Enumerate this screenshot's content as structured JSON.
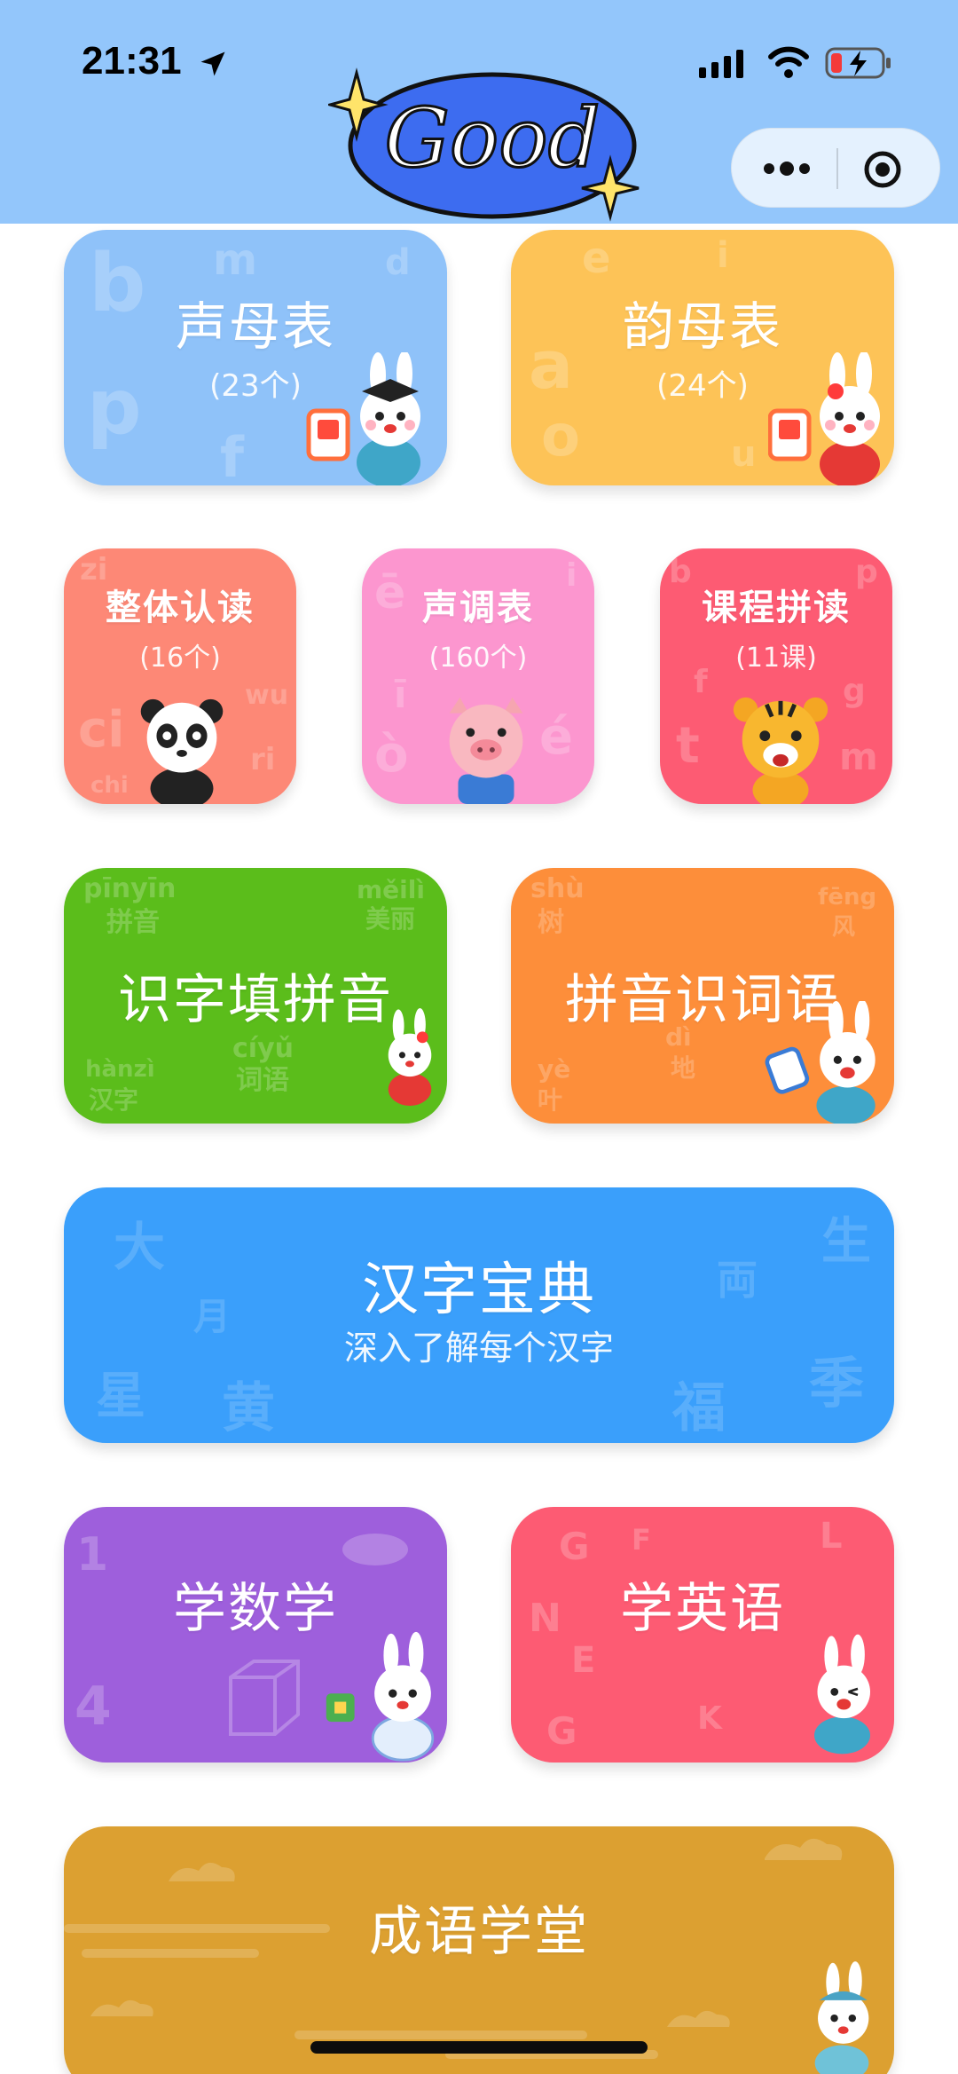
{
  "status_bar": {
    "time": "21:31"
  },
  "logo": {
    "text": "Good"
  },
  "colors": {
    "header": "#93c6fb",
    "shengmu": "#8fc2f9",
    "yunmu": "#fdc357",
    "zhengti": "#fd8876",
    "shengdiao": "#fc96cf",
    "kecheng": "#fd5b73",
    "shizi": "#5bbd1b",
    "pinyin": "#fd8e3a",
    "hanzi": "#3a9ffb",
    "shuxue": "#9e5fdc",
    "yingyu": "#fd5b73",
    "chengyu": "#dca031"
  },
  "cards": {
    "shengmu": {
      "title": "声母表",
      "count": "(23个)"
    },
    "yunmu": {
      "title": "韵母表",
      "count": "(24个)"
    },
    "zhengti": {
      "title": "整体认读",
      "count": "(16个)"
    },
    "shengdiao": {
      "title": "声调表",
      "count": "(160个)"
    },
    "kecheng": {
      "title": "课程拼读",
      "count": "(11课)"
    },
    "shizi": {
      "title": "识字填拼音"
    },
    "pinyin": {
      "title": "拼音识词语"
    },
    "hanzi": {
      "title": "汉字宝典",
      "subtitle": "深入了解每个汉字"
    },
    "shuxue": {
      "title": "学数学"
    },
    "yingyu": {
      "title": "学英语"
    },
    "chengyu": {
      "title": "成语学堂"
    }
  }
}
